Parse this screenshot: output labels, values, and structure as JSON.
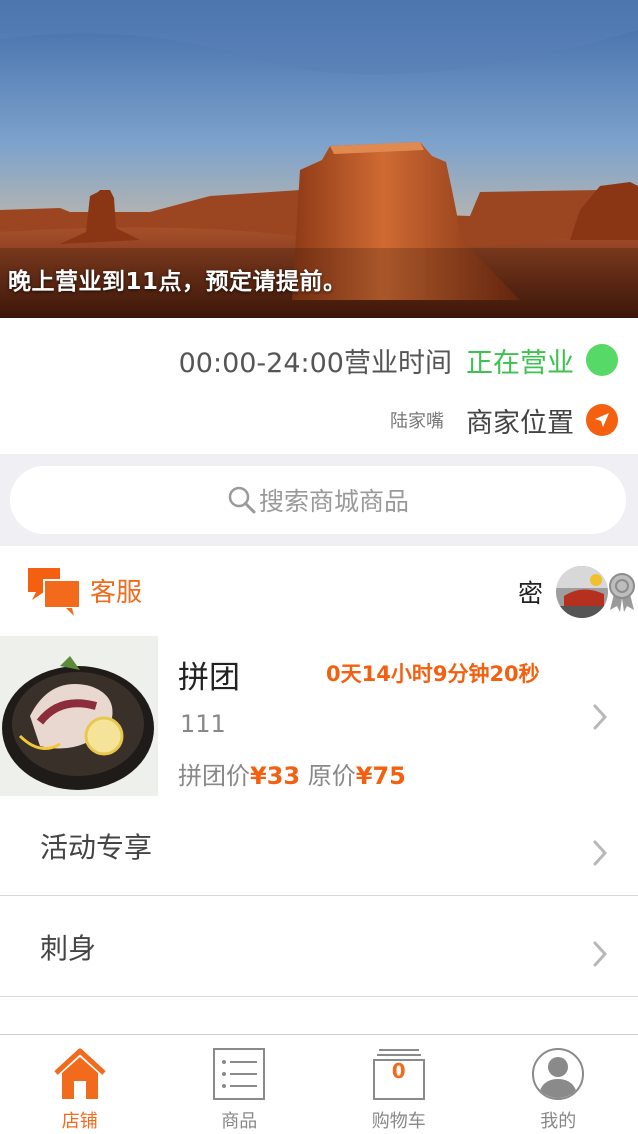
{
  "banner": {
    "caption": "晚上营业到11点，预定请提前。",
    "image": "desert-mesa-photo"
  },
  "store": {
    "hours": "00:00-24:00营业时间",
    "status": "正在营业",
    "status_color": "#56d966",
    "area": "陆家嘴",
    "location_label": "商家位置",
    "location_icon": "location-arrow-icon"
  },
  "search": {
    "placeholder": "搜索商城商品"
  },
  "service": {
    "label": "客服",
    "icon": "chat-bubbles-icon",
    "user_name": "密",
    "badge_icon": "award-ribbon-icon"
  },
  "group_buy": {
    "title": "拼团",
    "countdown": "0天14小时9分钟20秒",
    "item_id": "111",
    "group_price_label": "拼团价",
    "group_price": "¥33",
    "original_price_label": "原价",
    "original_price": "¥75"
  },
  "categories": [
    {
      "label": "活动专享"
    },
    {
      "label": "刺身"
    }
  ],
  "tabbar": {
    "items": [
      {
        "label": "店铺",
        "icon": "home-icon",
        "active": true
      },
      {
        "label": "商品",
        "icon": "list-icon",
        "active": false
      },
      {
        "label": "购物车",
        "icon": "cart-icon",
        "active": false,
        "count": "0"
      },
      {
        "label": "我的",
        "icon": "user-icon",
        "active": false
      }
    ]
  },
  "colors": {
    "accent": "#f26b1d",
    "price": "#f4600f",
    "open_green": "#3cc24e",
    "search_bg": "#efeff4"
  }
}
